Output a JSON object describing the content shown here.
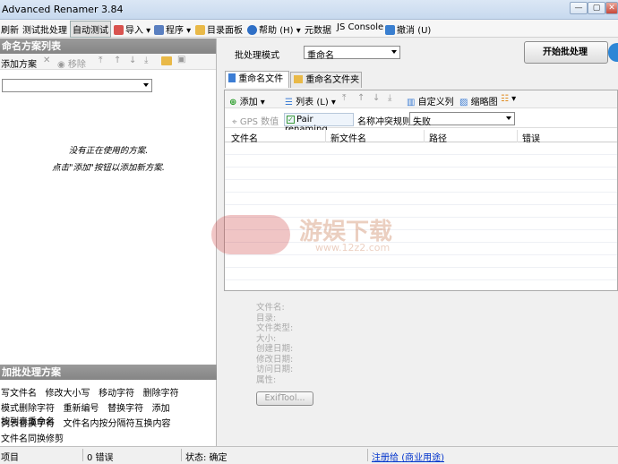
{
  "window": {
    "title": "Advanced Renamer 3.84",
    "minimize": "—",
    "maximize": "▢",
    "close": "✕"
  },
  "menu": {
    "refresh": "刷新",
    "test_batch": "测试批处理",
    "auto_test": "自动测试",
    "import": "导入",
    "programs": "程序",
    "dir_panel": "目录面板",
    "help": "帮助",
    "help_key": "(H)",
    "metadata": "元数据",
    "js_console": "JS Console",
    "undo": "撤消",
    "undo_key": "(U)"
  },
  "left": {
    "methods_header": "命名方案列表",
    "add_method": "添加方案",
    "remove": "移除",
    "empty_line1": "没有正在使用的方案.",
    "empty_line2": "点击\"添加\"按钮以添加新方案.",
    "batch_header": "加批处理方案",
    "batch_rows": [
      [
        "写文件名",
        "修改大小写",
        "移动字符",
        "删除字符"
      ],
      [
        "模式删除字符",
        "重新编号",
        "替换字符",
        "添加",
        "按列表重命名"
      ],
      [
        "列表替换字符",
        "文件名内按分隔符互换内容"
      ],
      [
        "文件名同换修剪"
      ]
    ]
  },
  "right": {
    "batch_mode_label": "批处理模式",
    "batch_mode_value": "重命名",
    "start_button": "开始批处理",
    "tabs": [
      "重命名文件",
      "重命名文件夹"
    ],
    "toolbar": {
      "add": "添加",
      "list": "列表",
      "list_key": "(L)",
      "custom_columns": "自定义列",
      "thumbnails": "缩略图"
    },
    "options": {
      "gps": "GPS 数值",
      "pair": "Pair renaming",
      "conflict_label": "名称冲突规则:",
      "conflict_value": "失败"
    },
    "columns": [
      "文件名",
      "新文件名",
      "路径",
      "错误"
    ],
    "info_labels": [
      "文件名:",
      "目录:",
      "文件类型:",
      "大小:",
      "创建日期:",
      "修改日期:",
      "访问日期:",
      "属性:"
    ],
    "exif_button": "ExifTool..."
  },
  "status": {
    "items": "项目",
    "errors": "0 错误",
    "state": "状态: 确定",
    "register": "注册给",
    "register_note": "(商业用途)"
  },
  "watermark": {
    "brand": "游娱下载",
    "url": "www.12z2.com"
  }
}
